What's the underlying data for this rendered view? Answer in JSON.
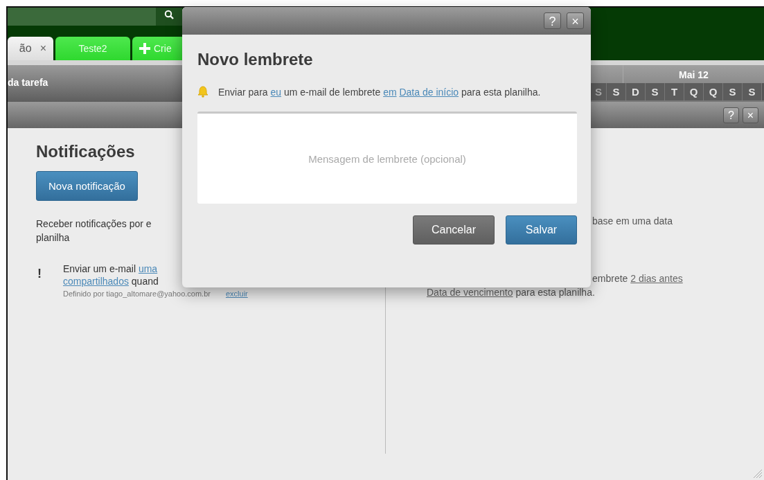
{
  "tabs": [
    {
      "label": "ão",
      "close": "×",
      "selected": true
    },
    {
      "label": "Teste2",
      "selected": false
    }
  ],
  "new_tab": {
    "label": "Crie"
  },
  "toolbar": {
    "title": "da tarefa"
  },
  "calendar": {
    "month": "Mai 12",
    "days": [
      "S",
      "S",
      "D",
      "S",
      "T",
      "Q",
      "Q",
      "S",
      "S"
    ]
  },
  "panel_bar": {
    "help": "?",
    "close": "×"
  },
  "notifications": {
    "title": "Notificações",
    "new_button": "Nova notificação",
    "description": [
      "Receber notificações por e",
      "planilha"
    ],
    "items": [
      {
        "marker": "!",
        "lines": [
          [
            {
              "text": "Enviar um e-mail "
            },
            {
              "text": "uma",
              "link": true
            }
          ],
          [
            {
              "text": "compartilhados",
              "link": true
            },
            {
              "text": " quand"
            }
          ]
        ],
        "author": "Definido por tiago_altomare@yahoo.com.br",
        "delete": "excluir"
      }
    ]
  },
  "reminders": {
    "lines": [
      [
        {
          "text": "base em uma data"
        }
      ],
      [
        {
          "text": "embrete "
        },
        {
          "text": "2 dias antes",
          "link": true
        }
      ],
      [
        {
          "text": "Data de vencimento",
          "link": true
        },
        {
          "text": " para esta planilha."
        }
      ]
    ]
  },
  "dialog": {
    "title": "Novo lembrete",
    "help": "?",
    "close": "×",
    "message": [
      {
        "text": "Enviar para "
      },
      {
        "text": "eu",
        "link": true
      },
      {
        "text": " um e-mail de lembrete "
      },
      {
        "text": "em",
        "link": true
      },
      {
        "text": "Data de início",
        "link": true
      },
      {
        "text": " para esta planilha."
      }
    ],
    "placeholder": "Mensagem de lembrete (opcional)",
    "buttons": [
      {
        "label": "Cancelar",
        "kind": "secondary"
      },
      {
        "label": "Salvar",
        "kind": "primary"
      }
    ]
  }
}
